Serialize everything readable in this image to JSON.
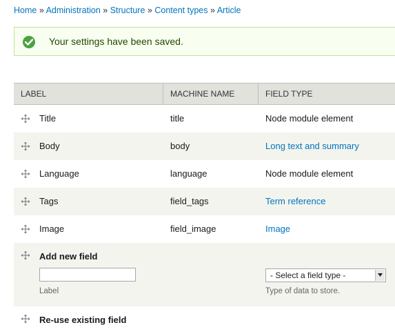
{
  "breadcrumb": {
    "items": [
      "Home",
      "Administration",
      "Structure",
      "Content types",
      "Article"
    ],
    "separator": "»"
  },
  "status": {
    "message": "Your settings have been saved.",
    "icon": "check-icon",
    "color": "#4aa340"
  },
  "table": {
    "headers": [
      "LABEL",
      "MACHINE NAME",
      "FIELD TYPE"
    ],
    "rows": [
      {
        "label": "Title",
        "machine": "title",
        "type": "Node module element",
        "type_is_link": false
      },
      {
        "label": "Body",
        "machine": "body",
        "type": "Long text and summary",
        "type_is_link": true
      },
      {
        "label": "Language",
        "machine": "language",
        "type": "Node module element",
        "type_is_link": false
      },
      {
        "label": "Tags",
        "machine": "field_tags",
        "type": "Term reference",
        "type_is_link": true
      },
      {
        "label": "Image",
        "machine": "field_image",
        "type": "Image",
        "type_is_link": true
      }
    ],
    "add_new": {
      "title": "Add new field",
      "input_value": "",
      "input_description": "Label",
      "select_value": "- Select a field type -",
      "select_description": "Type of data to store."
    },
    "reuse": {
      "title": "Re-use existing field"
    }
  },
  "colors": {
    "link": "#0074bd",
    "header_bg": "#e1e2dc",
    "row_alt_bg": "#f3f4ee",
    "message_bg": "#f8fff0",
    "message_border": "#bee3a0"
  }
}
